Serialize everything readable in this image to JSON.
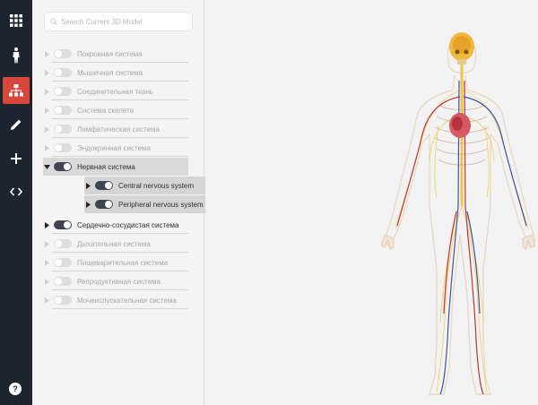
{
  "search": {
    "placeholder": "Search Current 3D Model"
  },
  "rail": {
    "items": [
      {
        "icon": "grid-icon"
      },
      {
        "icon": "human-figure-icon"
      },
      {
        "icon": "hierarchy-icon",
        "active": true
      },
      {
        "icon": "pencil-icon"
      },
      {
        "icon": "plus-icon"
      },
      {
        "icon": "code-icon"
      }
    ],
    "help_label": "?"
  },
  "systems": [
    {
      "label": "Покровная система",
      "on": false
    },
    {
      "label": "Мышечная система",
      "on": false
    },
    {
      "label": "Соединительная ткань",
      "on": false
    },
    {
      "label": "Система скелета",
      "on": false
    },
    {
      "label": "Лимфатическая система",
      "on": false
    },
    {
      "label": "Эндокринная система",
      "on": false
    },
    {
      "label": "Нервная система",
      "on": true,
      "expanded": true
    },
    {
      "label": "Сердечно-сосудистая система",
      "on": true
    },
    {
      "label": "Дыхательная система",
      "on": false
    },
    {
      "label": "Пищеварительная система",
      "on": false
    },
    {
      "label": "Репродуктивная система",
      "on": false
    },
    {
      "label": "Мочеиспускательная система",
      "on": false
    }
  ],
  "nervous_children": [
    {
      "label": "Central nervous system",
      "on": true
    },
    {
      "label": "Peripheral nervous system",
      "on": true
    }
  ],
  "colors": {
    "rail": "#1c2430",
    "accent": "#d9473b",
    "toggle_on": "#3d4552"
  }
}
